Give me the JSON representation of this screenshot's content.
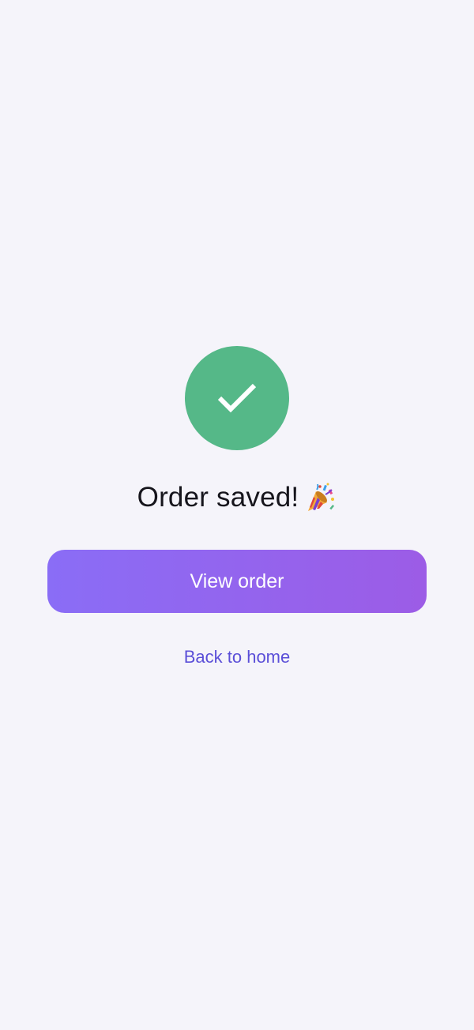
{
  "colors": {
    "background": "#f5f4fa",
    "success_green": "#55b888",
    "check_white": "#ffffff",
    "title_text": "#16151c",
    "button_gradient_start": "#8a6df6",
    "button_gradient_end": "#9c5ce6",
    "link_text": "#5b4fd8"
  },
  "success": {
    "icon": "checkmark-icon"
  },
  "title": {
    "text": "Order saved!",
    "emoji_icon": "party-popper-icon"
  },
  "actions": {
    "primary_label": "View order",
    "secondary_label": "Back to home"
  }
}
